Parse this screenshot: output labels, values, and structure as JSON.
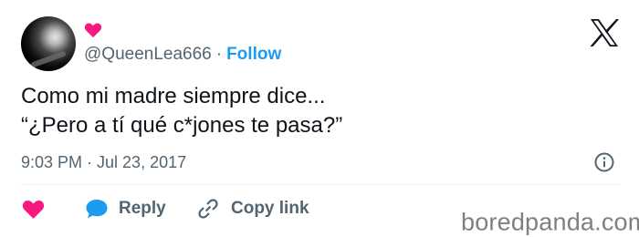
{
  "author": {
    "handle": "@QueenLea666",
    "separator": "·",
    "follow_label": "Follow",
    "avatar_icon": "profile-avatar-icon",
    "badge_icon": "heart-icon",
    "badge_color": "#f91880"
  },
  "tweet": {
    "lines": [
      "Como mi madre siempre dice...",
      "“¿Pero a tí qué c*jones te pasa?”"
    ],
    "timestamp": "9:03 PM · Jul 23, 2017"
  },
  "actions": {
    "like_icon": "heart-icon",
    "like_color": "#f91880",
    "reply_label": "Reply",
    "reply_icon": "speech-bubble-icon",
    "reply_color": "#1d9bf0",
    "copy_label": "Copy link",
    "copy_icon": "link-icon"
  },
  "header": {
    "logo_icon": "x-logo-icon",
    "info_icon": "info-icon"
  },
  "watermark": "boredpanda.com",
  "colors": {
    "accent": "#1d9bf0",
    "text": "#0f1419",
    "secondary": "#536471"
  }
}
